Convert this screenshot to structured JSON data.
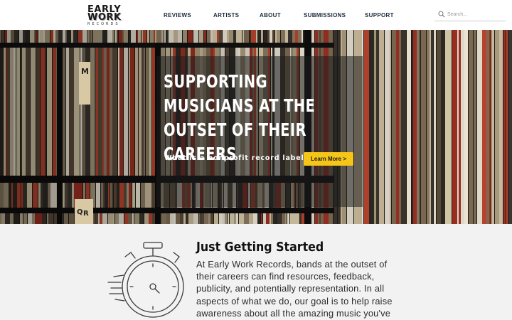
{
  "logo": {
    "line1": "EARLY",
    "line2": "WORK",
    "line3": "RECORDS"
  },
  "nav": {
    "items": [
      {
        "label": "REVIEWS"
      },
      {
        "label": "ARTISTS"
      },
      {
        "label": "ABOUT"
      },
      {
        "label": "SUBMISSIONS"
      },
      {
        "label": "SUPPORT"
      }
    ]
  },
  "search": {
    "placeholder": "Search...",
    "icon": "search-icon"
  },
  "hero": {
    "title": "SUPPORTING MUSICIANS AT THE OUTSET OF THEIR CAREERS",
    "question": "What is a nonprofit record label?",
    "button_label": "Learn More >",
    "button_color": "#f5c518",
    "divider_letters": [
      "M",
      "Q",
      "R"
    ]
  },
  "section": {
    "heading": "Just Getting Started",
    "body": "At Early Work Records, bands at the outset of their careers can find resources, feedback, publicity, and potentially representation. In all aspects of what we do, our goal is to help raise awareness about all the amazing music you've",
    "icon": "stopwatch-icon"
  }
}
